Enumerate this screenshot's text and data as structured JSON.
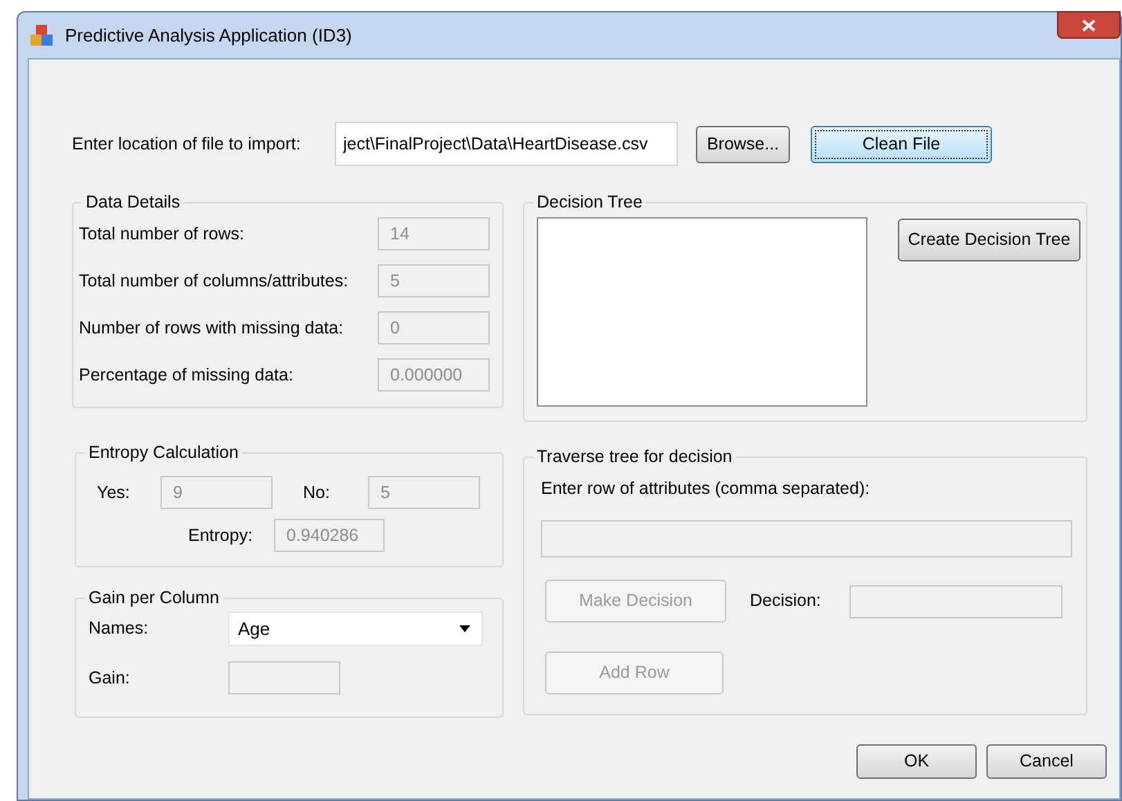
{
  "window": {
    "title": "Predictive Analysis Application (ID3)"
  },
  "import": {
    "label": "Enter location of file to import:",
    "value": "ject\\FinalProject\\Data\\HeartDisease.csv",
    "buttons": [
      {
        "label": "Browse...",
        "focused": false
      },
      {
        "label": "Clean File",
        "focused": true
      }
    ]
  },
  "data_details": {
    "title": "Data Details",
    "rows": [
      {
        "label": "Total number of rows:",
        "value": "14",
        "disabled": true
      },
      {
        "label": "Total number of columns/attributes:",
        "value": "5",
        "disabled": true
      },
      {
        "label": "Number of rows with missing data:",
        "value": "0",
        "disabled": true
      },
      {
        "label": "Percentage of missing data:",
        "value": "0.000000",
        "disabled": true
      }
    ]
  },
  "entropy": {
    "title": "Entropy Calculation",
    "fields": [
      {
        "label": "Yes:",
        "value": "9",
        "disabled": true
      },
      {
        "label": "No:",
        "value": "5",
        "disabled": true
      },
      {
        "label": "Entropy:",
        "value": "0.940286",
        "disabled": true
      }
    ]
  },
  "gain": {
    "title": "Gain per Column",
    "names_label": "Names:",
    "names_value": "Age",
    "gain_label": "Gain:",
    "gain_disabled": true
  },
  "decision_tree": {
    "title": "Decision Tree",
    "button": {
      "label": "Create Decision Tree",
      "disabled": false
    }
  },
  "traverse": {
    "title": "Traverse tree for decision",
    "prompt": "Enter row of attributes (comma separated):",
    "row_disabled": true,
    "decision_label": "Decision:",
    "decision_disabled": true,
    "buttons": [
      {
        "label": "Make Decision",
        "disabled": true
      },
      {
        "label": "Add Row",
        "disabled": true
      }
    ]
  },
  "footer_buttons": [
    {
      "label": "OK",
      "disabled": false
    },
    {
      "label": "Cancel",
      "disabled": false
    }
  ]
}
